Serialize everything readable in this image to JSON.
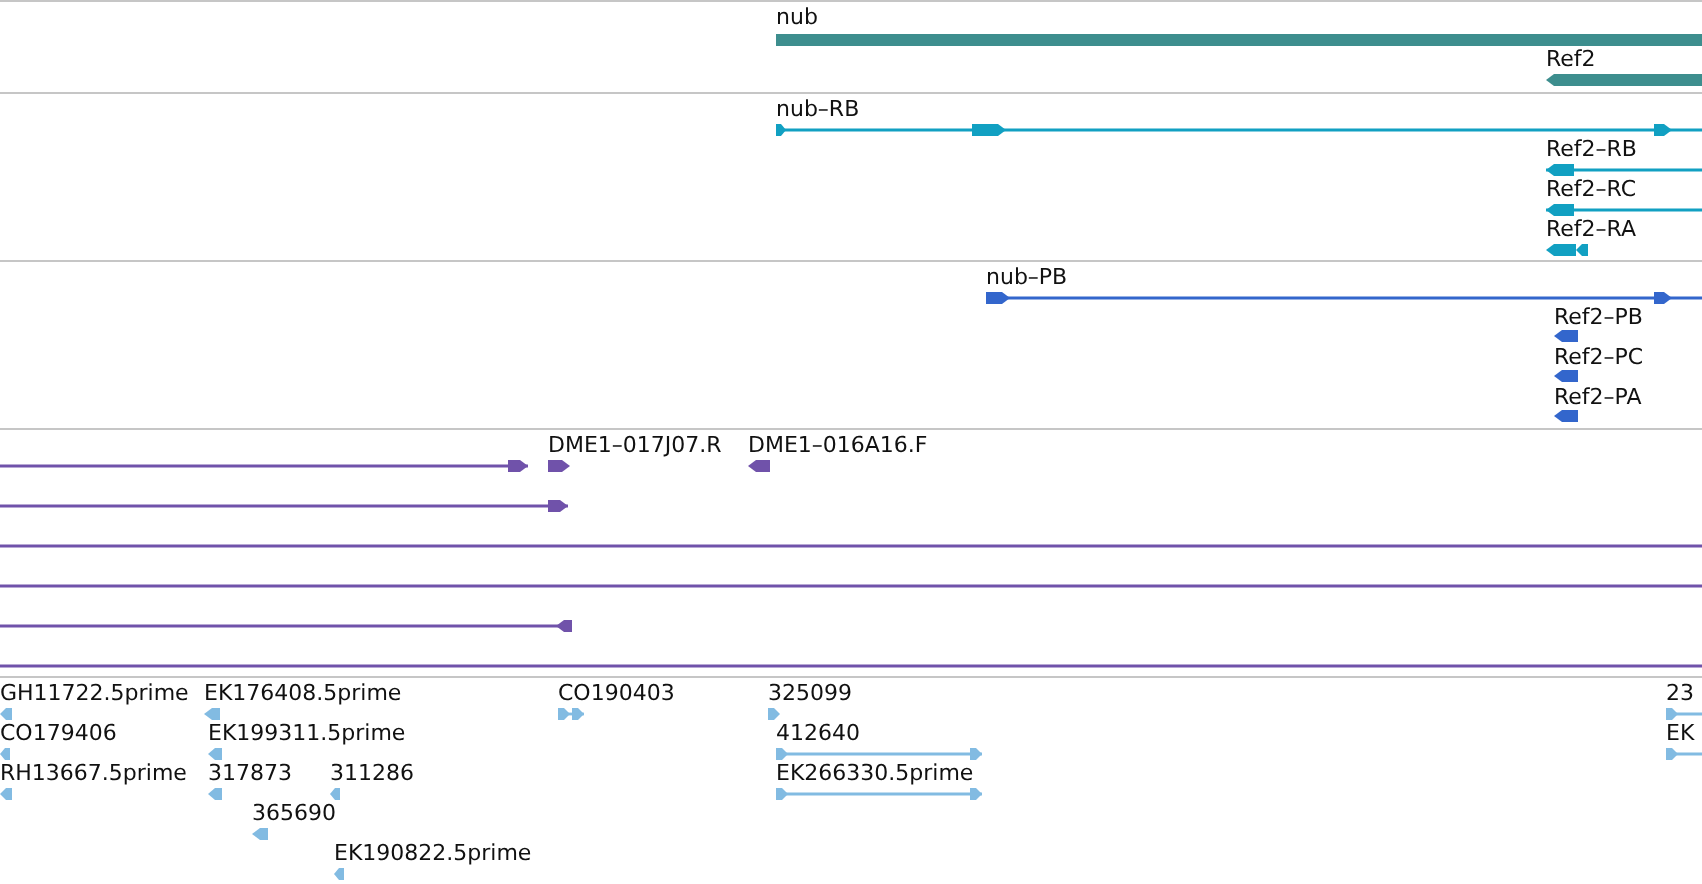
{
  "tracks": [
    {
      "features": [
        {
          "label": "nub"
        },
        {
          "label": "Ref2"
        }
      ]
    },
    {
      "features": [
        {
          "label": "nub–RB"
        },
        {
          "label": "Ref2–RB"
        },
        {
          "label": "Ref2–RC"
        },
        {
          "label": "Ref2–RA"
        }
      ]
    },
    {
      "features": [
        {
          "label": "nub–PB"
        },
        {
          "label": "Ref2–PB"
        },
        {
          "label": "Ref2–PC"
        },
        {
          "label": "Ref2–PA"
        }
      ]
    },
    {
      "features": [
        {
          "label": "DME1–017J07.R"
        },
        {
          "label": "DME1–016A16.F"
        }
      ]
    },
    {
      "features": [
        {
          "label": "GH11722.5prime"
        },
        {
          "label": "EK176408.5prime"
        },
        {
          "label": "CO190403"
        },
        {
          "label": "325099"
        },
        {
          "label": "23"
        },
        {
          "label": "CO179406"
        },
        {
          "label": "EK199311.5prime"
        },
        {
          "label": "412640"
        },
        {
          "label": "EK"
        },
        {
          "label": "RH13667.5prime"
        },
        {
          "label": "317873"
        },
        {
          "label": "311286"
        },
        {
          "label": "EK266330.5prime"
        },
        {
          "label": "365690"
        },
        {
          "label": "EK190822.5prime"
        }
      ]
    }
  ]
}
